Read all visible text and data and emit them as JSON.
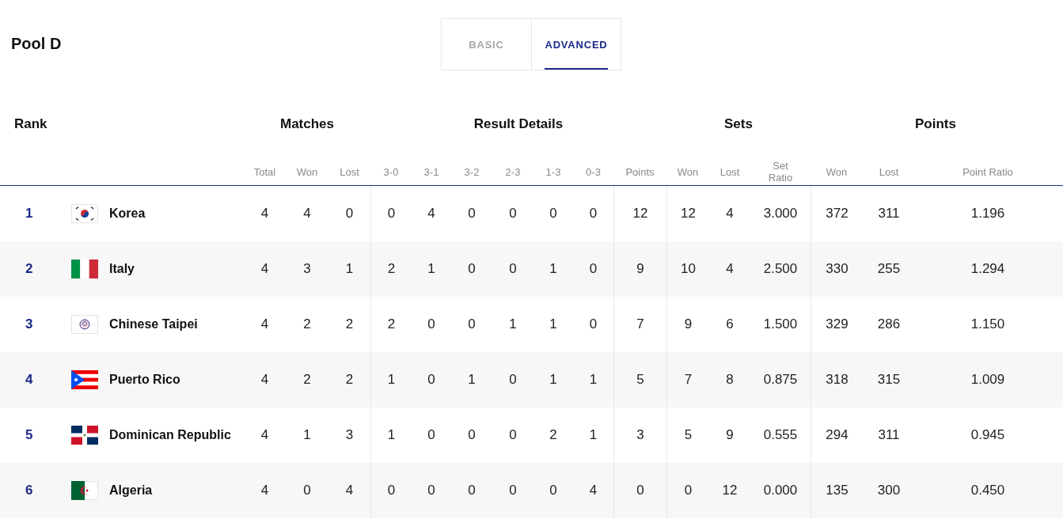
{
  "title": "Pool D",
  "tabs": [
    {
      "label": "BASIC",
      "selected": false
    },
    {
      "label": "ADVANCED",
      "selected": true
    }
  ],
  "table": {
    "group_headers": [
      {
        "label": "Rank",
        "kind": "rank"
      },
      {
        "label": "Matches",
        "kind": "matches"
      },
      {
        "label": "Result Details",
        "kind": "results"
      },
      {
        "label": "Sets",
        "kind": "sets"
      },
      {
        "label": "Points",
        "kind": "points"
      }
    ],
    "columns": [
      "Total",
      "Won",
      "Lost",
      "3-0",
      "3-1",
      "3-2",
      "2-3",
      "1-3",
      "0-3",
      "Points",
      "Won",
      "Lost",
      "Set Ratio",
      "Won",
      "Lost",
      "Point Ratio"
    ],
    "rows": [
      {
        "rank": "1",
        "kind": "kr",
        "team": "Korea",
        "values": [
          "4",
          "4",
          "0",
          "0",
          "4",
          "0",
          "0",
          "0",
          "0",
          "12",
          "12",
          "4",
          "3.000",
          "372",
          "311",
          "1.196"
        ]
      },
      {
        "rank": "2",
        "kind": "it",
        "team": "Italy",
        "values": [
          "4",
          "3",
          "1",
          "2",
          "1",
          "0",
          "0",
          "1",
          "0",
          "9",
          "10",
          "4",
          "2.500",
          "330",
          "255",
          "1.294"
        ]
      },
      {
        "rank": "3",
        "kind": "tpe",
        "team": "Chinese Taipei",
        "values": [
          "4",
          "2",
          "2",
          "2",
          "0",
          "0",
          "1",
          "1",
          "0",
          "7",
          "9",
          "6",
          "1.500",
          "329",
          "286",
          "1.150"
        ]
      },
      {
        "rank": "4",
        "kind": "pr",
        "team": "Puerto Rico",
        "values": [
          "4",
          "2",
          "2",
          "1",
          "0",
          "1",
          "0",
          "1",
          "1",
          "5",
          "7",
          "8",
          "0.875",
          "318",
          "315",
          "1.009"
        ]
      },
      {
        "rank": "5",
        "kind": "do",
        "team": "Dominican Republic",
        "values": [
          "4",
          "1",
          "3",
          "1",
          "0",
          "0",
          "0",
          "2",
          "1",
          "3",
          "5",
          "9",
          "0.555",
          "294",
          "311",
          "0.945"
        ]
      },
      {
        "rank": "6",
        "kind": "dz",
        "team": "Algeria",
        "values": [
          "4",
          "0",
          "4",
          "0",
          "0",
          "0",
          "0",
          "0",
          "4",
          "0",
          "0",
          "12",
          "0.000",
          "135",
          "300",
          "0.450"
        ]
      }
    ]
  }
}
